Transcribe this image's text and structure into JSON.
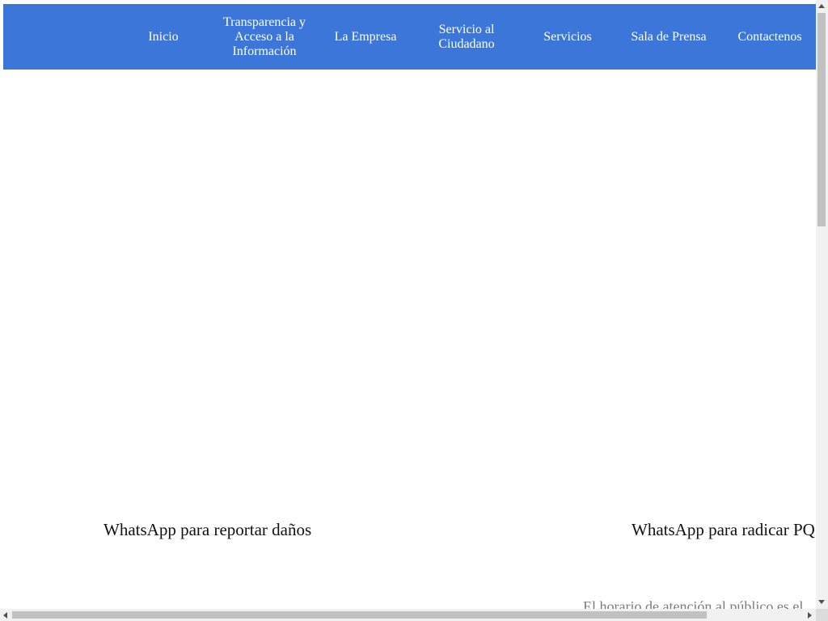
{
  "nav": {
    "items": [
      {
        "label": "Inicio"
      },
      {
        "label": "Transparencia y Acceso a la Información"
      },
      {
        "label": "La Empresa"
      },
      {
        "label": "Servicio al Ciudadano"
      },
      {
        "label": "Servicios"
      },
      {
        "label": "Sala de Prensa"
      },
      {
        "label": "Contactenos"
      }
    ],
    "background_color": "#3c76d8",
    "text_color": "#ffffff"
  },
  "main": {
    "whatsapp_damage_title": "WhatsApp para reportar daños",
    "whatsapp_pqr_title": "WhatsApp para radicar PQ",
    "schedule_text": "El horario de atención al público es el"
  }
}
